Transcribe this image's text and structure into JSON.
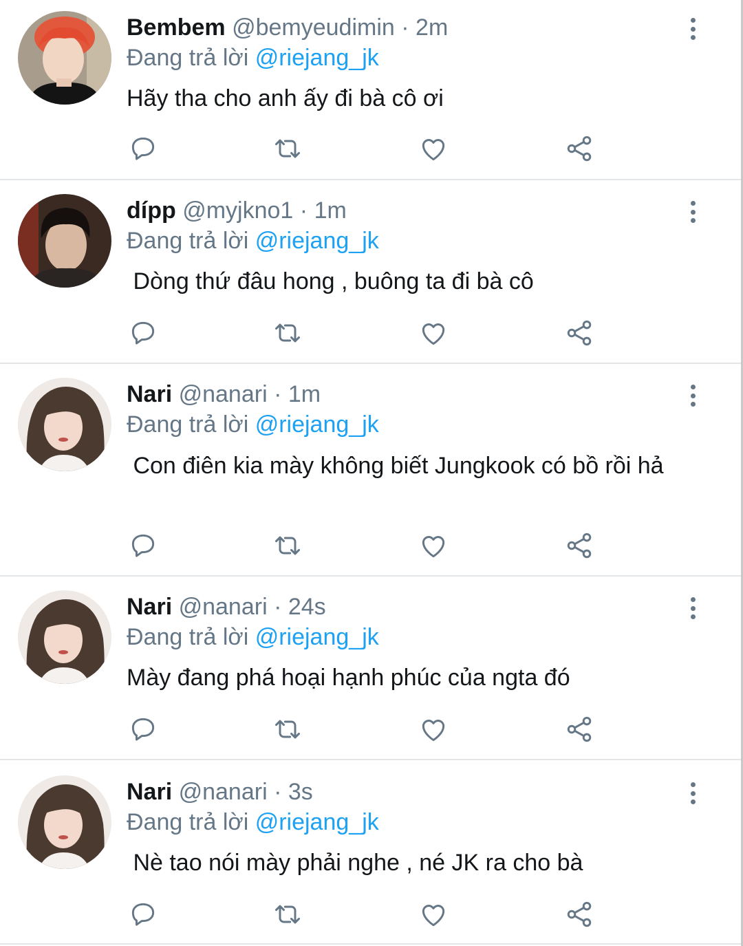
{
  "colors": {
    "accent": "#1da1f2",
    "muted": "#657786",
    "text": "#14171a"
  },
  "icons": {
    "reply": "reply-icon",
    "retweet": "retweet-icon",
    "like": "like-icon",
    "share": "share-icon",
    "more": "more-vertical-icon"
  },
  "tweets": [
    {
      "name": "Bembem",
      "handle": "@bemyeudimin",
      "dot": "·",
      "time": "2m",
      "replying_prefix": "Đang trả lời ",
      "replying_to": "@riejang_jk",
      "text": "Hãy tha cho anh ấy đi bà cô ơi"
    },
    {
      "name": "dípp",
      "handle": "@myjkno1",
      "dot": "·",
      "time": "1m",
      "replying_prefix": "Đang trả lời ",
      "replying_to": "@riejang_jk",
      "text": " Dòng thứ đâu hong , buông ta đi bà cô"
    },
    {
      "name": "Nari",
      "handle": "@nanari",
      "dot": "·",
      "time": "1m",
      "replying_prefix": "Đang trả lời ",
      "replying_to": "@riejang_jk",
      "text": " Con điên kia mày không biết Jungkook có bồ rồi hả"
    },
    {
      "name": "Nari",
      "handle": "@nanari",
      "dot": "·",
      "time": "24s",
      "replying_prefix": "Đang trả lời ",
      "replying_to": "@riejang_jk",
      "text": "Mày đang phá hoại hạnh phúc của ngta đó"
    },
    {
      "name": "Nari",
      "handle": "@nanari",
      "dot": "·",
      "time": "3s",
      "replying_prefix": "Đang trả lời ",
      "replying_to": "@riejang_jk",
      "text": " Nè tao nói mày phải nghe , né JK ra cho bà"
    }
  ]
}
